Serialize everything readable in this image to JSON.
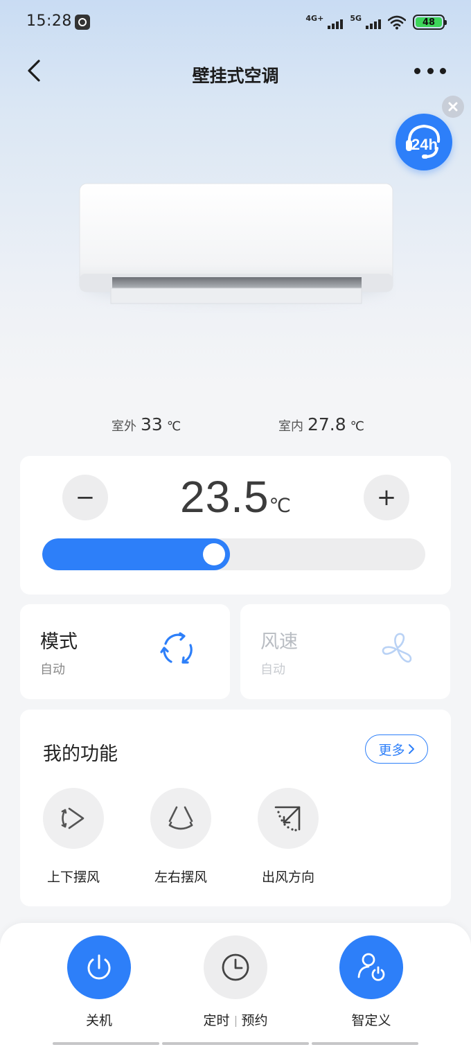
{
  "status_bar": {
    "time": "15:28",
    "net1": "4G+",
    "net2": "5G",
    "battery": "48"
  },
  "nav": {
    "title": "壁挂式空调"
  },
  "service": {
    "badge": "24h"
  },
  "outdoor": {
    "label": "室外",
    "value": "33",
    "unit": "℃"
  },
  "indoor": {
    "label": "室内",
    "value": "27.8",
    "unit": "℃"
  },
  "temperature": {
    "minus": "−",
    "plus": "+",
    "value": "23.5",
    "unit": "℃",
    "slider_fraction": 0.49
  },
  "mode": {
    "title": "模式",
    "value": "自动",
    "icon": "cycle-icon"
  },
  "fan_speed": {
    "title": "风速",
    "value": "自动",
    "icon": "fan-icon"
  },
  "functions": {
    "title": "我的功能",
    "more": "更多",
    "items": [
      {
        "label": "上下摆风",
        "icon": "vertical-swing-icon"
      },
      {
        "label": "左右摆风",
        "icon": "horizontal-swing-icon"
      },
      {
        "label": "出风方向",
        "icon": "airflow-direction-icon"
      }
    ]
  },
  "bottom": {
    "power": "关机",
    "timer_a": "定时",
    "timer_b": "预约",
    "custom": "智定义"
  },
  "colors": {
    "accent": "#2d7ff9",
    "background": "#f4f5f7",
    "battery": "#3dd55a"
  }
}
